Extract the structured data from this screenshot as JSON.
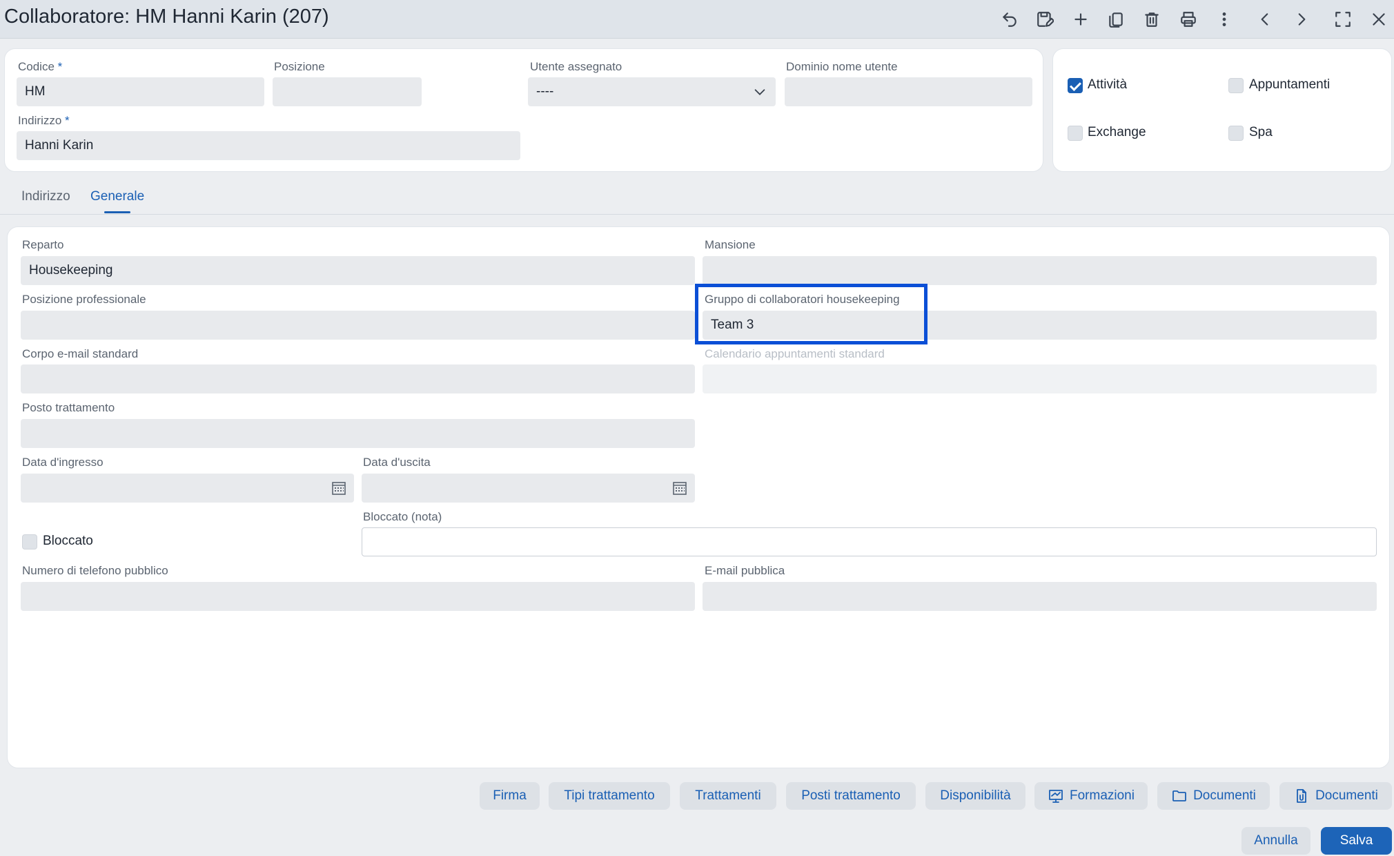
{
  "window": {
    "title": "Collaboratore: HM Hanni Karin (207)"
  },
  "toolbar": {
    "icons": [
      "undo-icon",
      "save-edit-icon",
      "add-icon",
      "copy-icon",
      "delete-icon",
      "print-icon",
      "more-vertical-icon",
      "chevron-left-icon",
      "chevron-right-icon",
      "fullscreen-icon",
      "close-icon"
    ]
  },
  "header_form": {
    "codice": {
      "label": "Codice",
      "required_mark": "*",
      "value": "HM"
    },
    "posizione": {
      "label": "Posizione",
      "value": ""
    },
    "utente_assegnato": {
      "label": "Utente assegnato",
      "value": "----"
    },
    "dominio": {
      "label": "Dominio nome utente",
      "value": ""
    },
    "indirizzo": {
      "label": "Indirizzo",
      "required_mark": "*",
      "value": "Hanni Karin"
    }
  },
  "flags": {
    "attivita": {
      "label": "Attività",
      "checked": true
    },
    "appuntamenti": {
      "label": "Appuntamenti",
      "checked": false
    },
    "exchange": {
      "label": "Exchange",
      "checked": false
    },
    "spa": {
      "label": "Spa",
      "checked": false
    }
  },
  "tabs": [
    {
      "label": "Indirizzo",
      "active": false
    },
    {
      "label": "Generale",
      "active": true
    }
  ],
  "generale": {
    "reparto": {
      "label": "Reparto",
      "value": "Housekeeping"
    },
    "mansione": {
      "label": "Mansione",
      "value": ""
    },
    "posizione_professionale": {
      "label": "Posizione professionale",
      "value": ""
    },
    "gruppo_housekeeping": {
      "label": "Gruppo di collaboratori housekeeping",
      "value": "Team 3"
    },
    "corpo_email": {
      "label": "Corpo e-mail standard",
      "value": ""
    },
    "calendario": {
      "label": "Calendario appuntamenti standard",
      "value": ""
    },
    "posto_trattamento": {
      "label": "Posto trattamento",
      "value": ""
    },
    "data_ingresso": {
      "label": "Data d'ingresso",
      "value": ""
    },
    "data_uscita": {
      "label": "Data d'uscita",
      "value": ""
    },
    "bloccato": {
      "label": "Bloccato",
      "checked": false
    },
    "bloccato_nota": {
      "label": "Bloccato (nota)",
      "value": ""
    },
    "telefono_pubblico": {
      "label": "Numero di telefono pubblico",
      "value": ""
    },
    "email_pubblica": {
      "label": "E-mail pubblica",
      "value": ""
    }
  },
  "action_buttons": {
    "firma": "Firma",
    "tipi_trattamento": "Tipi trattamento",
    "trattamenti": "Trattamenti",
    "posti_trattamento": "Posti trattamento",
    "disponibilita": "Disponibilità",
    "formazioni": "Formazioni",
    "documenti_folder": "Documenti",
    "documenti_file": "Documenti"
  },
  "footer": {
    "annulla": "Annulla",
    "salva": "Salva"
  },
  "colors": {
    "accent": "#1a5fb4",
    "highlight_border": "#0b4fd6",
    "primary_button": "#1d64b8"
  }
}
